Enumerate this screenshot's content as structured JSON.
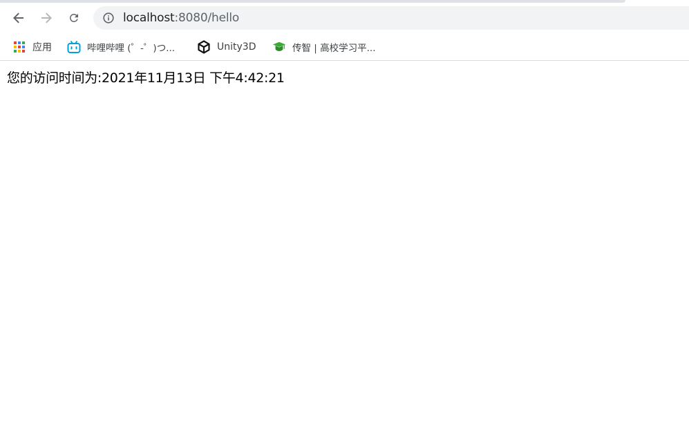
{
  "browser": {
    "address_bar": {
      "host": "localhost",
      "path": ":8080/hello"
    },
    "bookmarks": [
      {
        "label": "应用",
        "icon": "apps-grid-icon"
      },
      {
        "label": "哔哩哔哩 (゜-゜)つ...",
        "icon": "bilibili-icon"
      },
      {
        "label": "Unity3D",
        "icon": "unity-icon"
      },
      {
        "label": "传智 | 高校学习平...",
        "icon": "chuanzhi-icon"
      }
    ]
  },
  "page": {
    "message": "您的访问时间为:2021年11月13日 下午4:42:21"
  },
  "colors": {
    "bilibili": "#00a1d6",
    "chuanzhi": "#3aa935",
    "omnibox": "#f1f3f4"
  }
}
